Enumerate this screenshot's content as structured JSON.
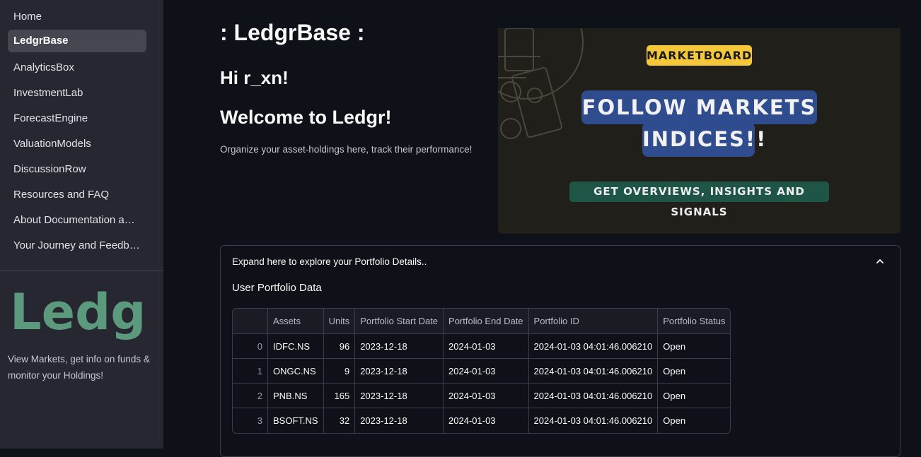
{
  "sidebar": {
    "items": [
      {
        "label": "Home"
      },
      {
        "label": "LedgrBase"
      },
      {
        "label": "AnalyticsBox"
      },
      {
        "label": "InvestmentLab"
      },
      {
        "label": "ForecastEngine"
      },
      {
        "label": "ValuationModels"
      },
      {
        "label": "DiscussionRow"
      },
      {
        "label": "Resources and FAQ"
      },
      {
        "label": "About Documentation a…"
      },
      {
        "label": "Your Journey and Feedb…"
      }
    ],
    "active_index": 1,
    "logo_text": "Ledgr",
    "logo_color": "#5c9a7e",
    "caption": "View Markets, get info on funds & monitor your Holdings!"
  },
  "main": {
    "title": ": LedgrBase :",
    "greeting": "Hi r_xn!",
    "welcome": "Welcome to Ledgr!",
    "subtitle": "Organize your asset-holdings here, track their performance!"
  },
  "banner": {
    "tag": "MARKETBOARD",
    "headline_1": "FOLLOW MARKETS &",
    "headline_2": "INDICES!!",
    "footer": "GET OVERVIEWS, INSIGHTS AND SIGNALS",
    "colors": {
      "tag": "#f5c73a",
      "headline": "#2e4c8e",
      "footer": "#1f5547"
    }
  },
  "expander": {
    "label": "Expand here to explore your Portfolio Details..",
    "expanded": true,
    "section_title": "User Portfolio Data",
    "table": {
      "columns": [
        "",
        "Assets",
        "Units",
        "Portfolio Start Date",
        "Portfolio End Date",
        "Portfolio ID",
        "Portfolio Status"
      ],
      "rows": [
        [
          "0",
          "IDFC.NS",
          "96",
          "2023-12-18",
          "2024-01-03",
          "2024-01-03 04:01:46.006210",
          "Open"
        ],
        [
          "1",
          "ONGC.NS",
          "9",
          "2023-12-18",
          "2024-01-03",
          "2024-01-03 04:01:46.006210",
          "Open"
        ],
        [
          "2",
          "PNB.NS",
          "165",
          "2023-12-18",
          "2024-01-03",
          "2024-01-03 04:01:46.006210",
          "Open"
        ],
        [
          "3",
          "BSOFT.NS",
          "32",
          "2023-12-18",
          "2024-01-03",
          "2024-01-03 04:01:46.006210",
          "Open"
        ]
      ]
    }
  }
}
